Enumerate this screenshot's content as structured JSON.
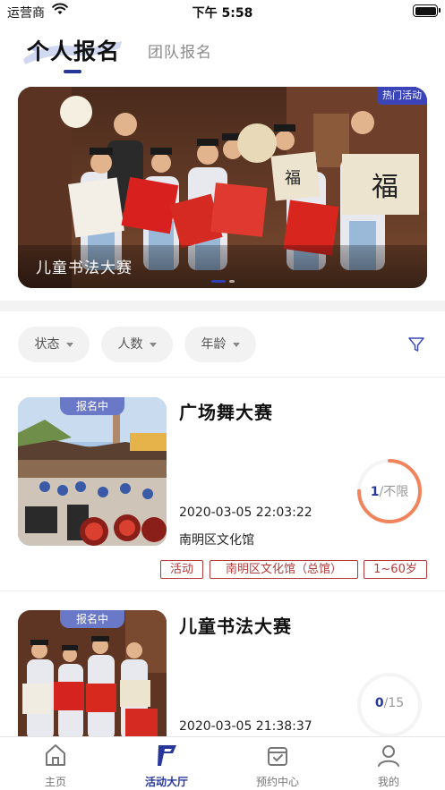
{
  "status_bar": {
    "carrier": "运营商",
    "time": "下午 5:58"
  },
  "top_tabs": [
    {
      "label": "个人报名",
      "active": true
    },
    {
      "label": "团队报名",
      "active": false
    }
  ],
  "banner": {
    "tag": "热门活动",
    "caption": "儿童书法大赛",
    "slide_count": 2,
    "active_slide": 1
  },
  "filters": [
    {
      "label": "状态"
    },
    {
      "label": "人数"
    },
    {
      "label": "年龄"
    }
  ],
  "filter_icon": "funnel-icon",
  "activities": [
    {
      "status": "报名中",
      "title": "广场舞大赛",
      "time": "2020-03-05 22:03:22",
      "venue": "南明区文化馆",
      "count": "1",
      "capacity": "/不限",
      "fill": 0.75,
      "tags": [
        "活动",
        "南明区文化馆（总馆）",
        "1~60岁"
      ]
    },
    {
      "status": "报名中",
      "title": "儿童书法大赛",
      "time": "2020-03-05 21:38:37",
      "venue": "",
      "count": "0",
      "capacity": "/15",
      "fill": 0,
      "tags": []
    }
  ],
  "bottom_nav": [
    {
      "label": "主页",
      "icon": "home-icon",
      "active": false
    },
    {
      "label": "活动大厅",
      "icon": "flag-icon",
      "active": true
    },
    {
      "label": "预约中心",
      "icon": "calendar-check-icon",
      "active": false
    },
    {
      "label": "我的",
      "icon": "user-icon",
      "active": false
    }
  ],
  "colors": {
    "accent": "#27389a",
    "badge": "#6a78c8",
    "tag": "#b33a3a",
    "ring": "#f0845c"
  }
}
